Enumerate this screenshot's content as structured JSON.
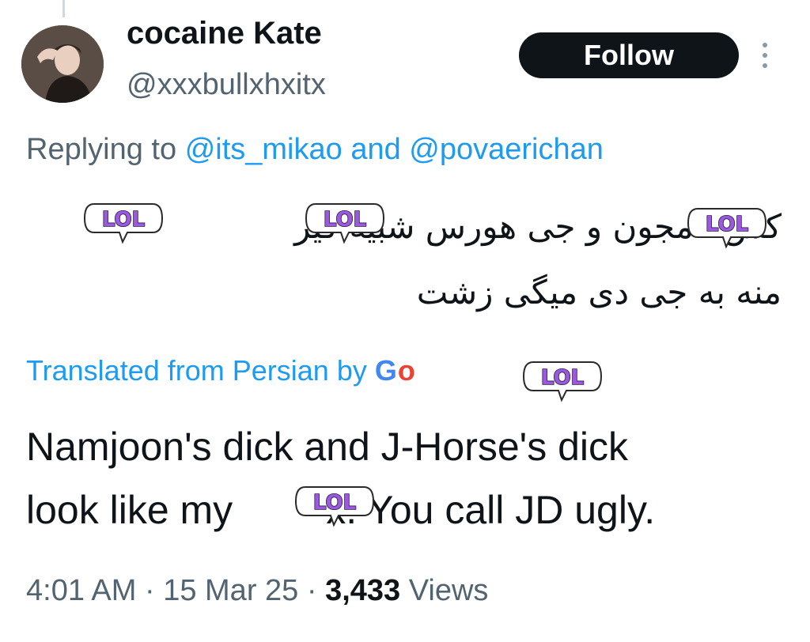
{
  "tweet": {
    "author": {
      "display_name": "cocaine Kate",
      "handle": "@xxxbullxhxitx"
    },
    "follow_label": "Follow",
    "more_icon": "more-vertical-icon",
    "reply_context": {
      "prefix": "Replying to",
      "mention_1": "@its_mikao",
      "joiner": "and",
      "mention_2": "@povaerichan"
    },
    "original_text": {
      "line_1": "کس نامجون و جی هورس شبیه کیر",
      "line_2": "منه به جی دی میگی زشت"
    },
    "translation_credit": {
      "prefix": "Translated from Persian by",
      "provider": "Google"
    },
    "translated_text": {
      "line_1": "Namjoon's dick and J-Horse's dick",
      "line_2_start": "look like my",
      "line_2_end": "x. You call JD ugly."
    },
    "meta": {
      "time": "4:01 AM",
      "separator": "·",
      "date": "15 Mar 25",
      "views_count": "3,433",
      "views_label": "Views"
    },
    "stickers": {
      "label": "LOL",
      "icon": "lol-speech-bubble-sticker"
    },
    "colors": {
      "link": "#1d9bf0",
      "secondary_text": "#536471",
      "follow_bg": "#0f1419",
      "sticker_fill": "#9b59e0"
    }
  }
}
